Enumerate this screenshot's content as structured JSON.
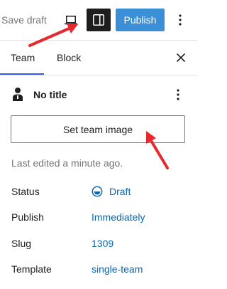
{
  "toolbar": {
    "save_draft_label": "Save draft",
    "preview_icon": "laptop-icon",
    "settings_icon": "sidebar-toggle-icon",
    "publish_label": "Publish",
    "options_icon": "vertical-ellipsis-icon"
  },
  "tabs": [
    {
      "label": "Team",
      "active": true
    },
    {
      "label": "Block",
      "active": false
    }
  ],
  "close_icon": "close-icon",
  "post": {
    "icon": "person-icon",
    "title": "No title",
    "menu_icon": "vertical-ellipsis-icon"
  },
  "featured_image": {
    "button_label": "Set team image"
  },
  "last_edited": "Last edited a minute ago.",
  "meta": {
    "status": {
      "label": "Status",
      "value": "Draft",
      "icon": "draft-status-icon"
    },
    "publish": {
      "label": "Publish",
      "value": "Immediately"
    },
    "slug": {
      "label": "Slug",
      "value": "1309"
    },
    "template": {
      "label": "Template",
      "value": "single-team"
    }
  },
  "annotations": {
    "arrow_color": "#e8282f"
  },
  "colors": {
    "accent": "#3858e9",
    "publish_bg": "#3b8fd6",
    "link": "#0b66ad",
    "muted_text": "#757575",
    "dark": "#1e1e1e"
  }
}
